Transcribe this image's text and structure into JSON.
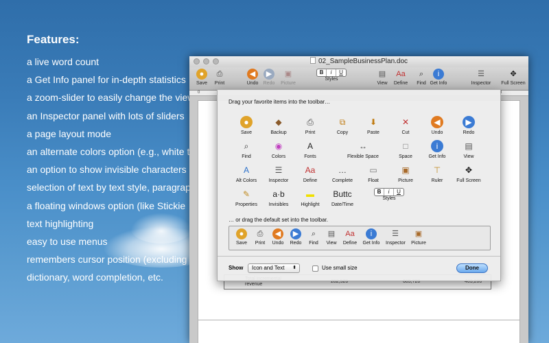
{
  "features": {
    "title": "Features:",
    "lines": [
      "a live word count",
      "a Get Info panel for in-depth statistics",
      "a zoom-slider to easily change the view",
      "an Inspector panel with lots of sliders",
      "a page layout mode",
      "an alternate colors option (e.g., white t",
      "an option to show invisible characters",
      "selection of text by text style, paragrap",
      "a floating windows option (like Stickie",
      "text highlighting",
      "easy to use menus",
      "remembers cursor position (excluding",
      "dictionary, word completion, etc."
    ]
  },
  "window": {
    "title": "02_SampleBusinessPlan.doc",
    "toolbar": [
      {
        "label": "Save",
        "icon": "save-icon",
        "glyph": "●",
        "color": "#e0a32a"
      },
      {
        "label": "Print",
        "icon": "print-icon",
        "glyph": "⎙",
        "color": "#444"
      },
      {
        "label": "Undo",
        "icon": "undo-icon",
        "glyph": "◀",
        "color": "#e07a20"
      },
      {
        "label": "Redo",
        "icon": "redo-icon",
        "glyph": "▶",
        "color": "#9aaac0",
        "dim": true
      },
      {
        "label": "Picture",
        "icon": "picture-icon",
        "glyph": "▣",
        "color": "#a88",
        "dim": true
      },
      {
        "label": "Styles",
        "icon": "styles-icon",
        "glyph": "B i U",
        "color": "#111"
      },
      {
        "label": "View",
        "icon": "view-icon",
        "glyph": "▤",
        "color": "#555"
      },
      {
        "label": "Define",
        "icon": "define-icon",
        "glyph": "Aa",
        "color": "#c03030"
      },
      {
        "label": "Find",
        "icon": "find-icon",
        "glyph": "⌕",
        "color": "#333"
      },
      {
        "label": "Get Info",
        "icon": "get-info-icon",
        "glyph": "i",
        "color": "#3b7bd4"
      },
      {
        "label": "Inspector",
        "icon": "inspector-icon",
        "glyph": "☰",
        "color": "#555"
      },
      {
        "label": "Full Screen",
        "icon": "full-screen-icon",
        "glyph": "✥",
        "color": "#111"
      }
    ],
    "ruler_mark": "0",
    "ruler_mark_right": "8",
    "table_row": {
      "label": "Total incremental revenue",
      "v1": "282,520",
      "v2": "685,720",
      "v3": "403,200"
    }
  },
  "sheet": {
    "hint_top": "Drag your favorite items into the toolbar…",
    "hint_default": "… or drag the default set into the toolbar.",
    "items": [
      {
        "label": "Save",
        "icon": "save-icon",
        "glyph": "●",
        "color": "#e0a32a"
      },
      {
        "label": "Backup",
        "icon": "backup-icon",
        "glyph": "◆",
        "color": "#8a5a2a"
      },
      {
        "label": "Print",
        "icon": "print-icon",
        "glyph": "⎙",
        "color": "#444"
      },
      {
        "label": "Copy",
        "icon": "copy-icon",
        "glyph": "⧉",
        "color": "#c07a10"
      },
      {
        "label": "Paste",
        "icon": "paste-icon",
        "glyph": "⬇",
        "color": "#c07a10"
      },
      {
        "label": "Cut",
        "icon": "cut-icon",
        "glyph": "✕",
        "color": "#c03030"
      },
      {
        "label": "Undo",
        "icon": "undo-icon",
        "glyph": "◀",
        "color": "#e07a20"
      },
      {
        "label": "Redo",
        "icon": "redo-icon",
        "glyph": "▶",
        "color": "#3b7bd4"
      },
      {
        "label": "Find",
        "icon": "find-icon",
        "glyph": "⌕",
        "color": "#333"
      },
      {
        "label": "Colors",
        "icon": "colors-icon",
        "glyph": "◉",
        "color": "#c040c0"
      },
      {
        "label": "Fonts",
        "icon": "fonts-icon",
        "glyph": "A",
        "color": "#222"
      },
      {
        "label": "Flexible Space",
        "icon": "flexible-space-icon",
        "glyph": "↔",
        "color": "#555"
      },
      {
        "label": "Space",
        "icon": "space-icon",
        "glyph": "□",
        "color": "#777"
      },
      {
        "label": "Get Info",
        "icon": "get-info-icon",
        "glyph": "i",
        "color": "#3b7bd4"
      },
      {
        "label": "View",
        "icon": "view-icon",
        "glyph": "▤",
        "color": "#555"
      },
      {
        "label": "Alt Colors",
        "icon": "alt-colors-icon",
        "glyph": "A",
        "color": "#2a6fc9"
      },
      {
        "label": "Inspector",
        "icon": "inspector-icon",
        "glyph": "☰",
        "color": "#555"
      },
      {
        "label": "Define",
        "icon": "define-icon",
        "glyph": "Aa",
        "color": "#c03030"
      },
      {
        "label": "Complete",
        "icon": "complete-icon",
        "glyph": "…",
        "color": "#333"
      },
      {
        "label": "Float",
        "icon": "float-icon",
        "glyph": "▭",
        "color": "#777"
      },
      {
        "label": "Picture",
        "icon": "picture-icon",
        "glyph": "▣",
        "color": "#a86a2a"
      },
      {
        "label": "Ruler",
        "icon": "ruler-icon",
        "glyph": "⊤",
        "color": "#c08a20"
      },
      {
        "label": "Full Screen",
        "icon": "full-screen-icon",
        "glyph": "✥",
        "color": "#111"
      },
      {
        "label": "Properties",
        "icon": "properties-icon",
        "glyph": "✎",
        "color": "#c08a20"
      },
      {
        "label": "Invisibles",
        "icon": "invisibles-icon",
        "glyph": "a·b",
        "color": "#222"
      },
      {
        "label": "Highlight",
        "icon": "highlight-icon",
        "glyph": "▬",
        "color": "#f0e000"
      },
      {
        "label": "Date/Time",
        "icon": "date-time-icon",
        "glyph": "Buttc",
        "color": "#222"
      },
      {
        "label": "Styles",
        "icon": "styles-icon",
        "glyph": "B i U",
        "color": "#111"
      }
    ],
    "default_set": [
      {
        "label": "Save",
        "icon": "save-icon",
        "glyph": "●",
        "color": "#e0a32a"
      },
      {
        "label": "Print",
        "icon": "print-icon",
        "glyph": "⎙",
        "color": "#444"
      },
      {
        "label": "Undo",
        "icon": "undo-icon",
        "glyph": "◀",
        "color": "#e07a20"
      },
      {
        "label": "Redo",
        "icon": "redo-icon",
        "glyph": "▶",
        "color": "#3b7bd4"
      },
      {
        "label": "Find",
        "icon": "find-icon",
        "glyph": "⌕",
        "color": "#333"
      },
      {
        "label": "View",
        "icon": "view-icon",
        "glyph": "▤",
        "color": "#555"
      },
      {
        "label": "Define",
        "icon": "define-icon",
        "glyph": "Aa",
        "color": "#c03030"
      },
      {
        "label": "Get Info",
        "icon": "get-info-icon",
        "glyph": "i",
        "color": "#3b7bd4"
      },
      {
        "label": "Inspector",
        "icon": "inspector-icon",
        "glyph": "☰",
        "color": "#555"
      },
      {
        "label": "Picture",
        "icon": "picture-icon",
        "glyph": "▣",
        "color": "#a86a2a"
      }
    ],
    "show_label": "Show",
    "show_value": "Icon and Text",
    "small_size_label": "Use small size",
    "done_label": "Done"
  }
}
